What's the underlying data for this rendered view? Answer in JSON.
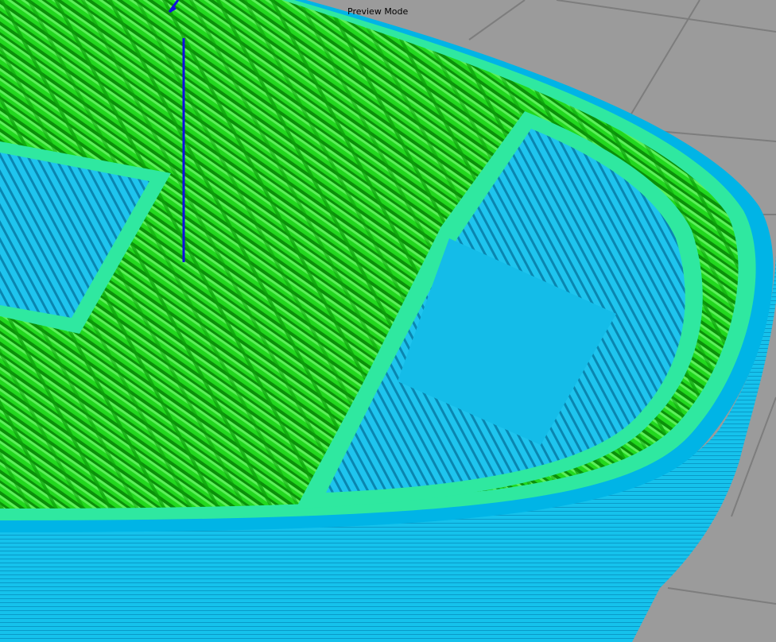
{
  "viewport": {
    "mode_label": "Preview Mode"
  },
  "colors": {
    "background": "#9b9b9b",
    "infill": "#22e01e",
    "skin": "#00c8f0",
    "wall_inner": "#2fe8a0",
    "axis": "#1010e0"
  }
}
